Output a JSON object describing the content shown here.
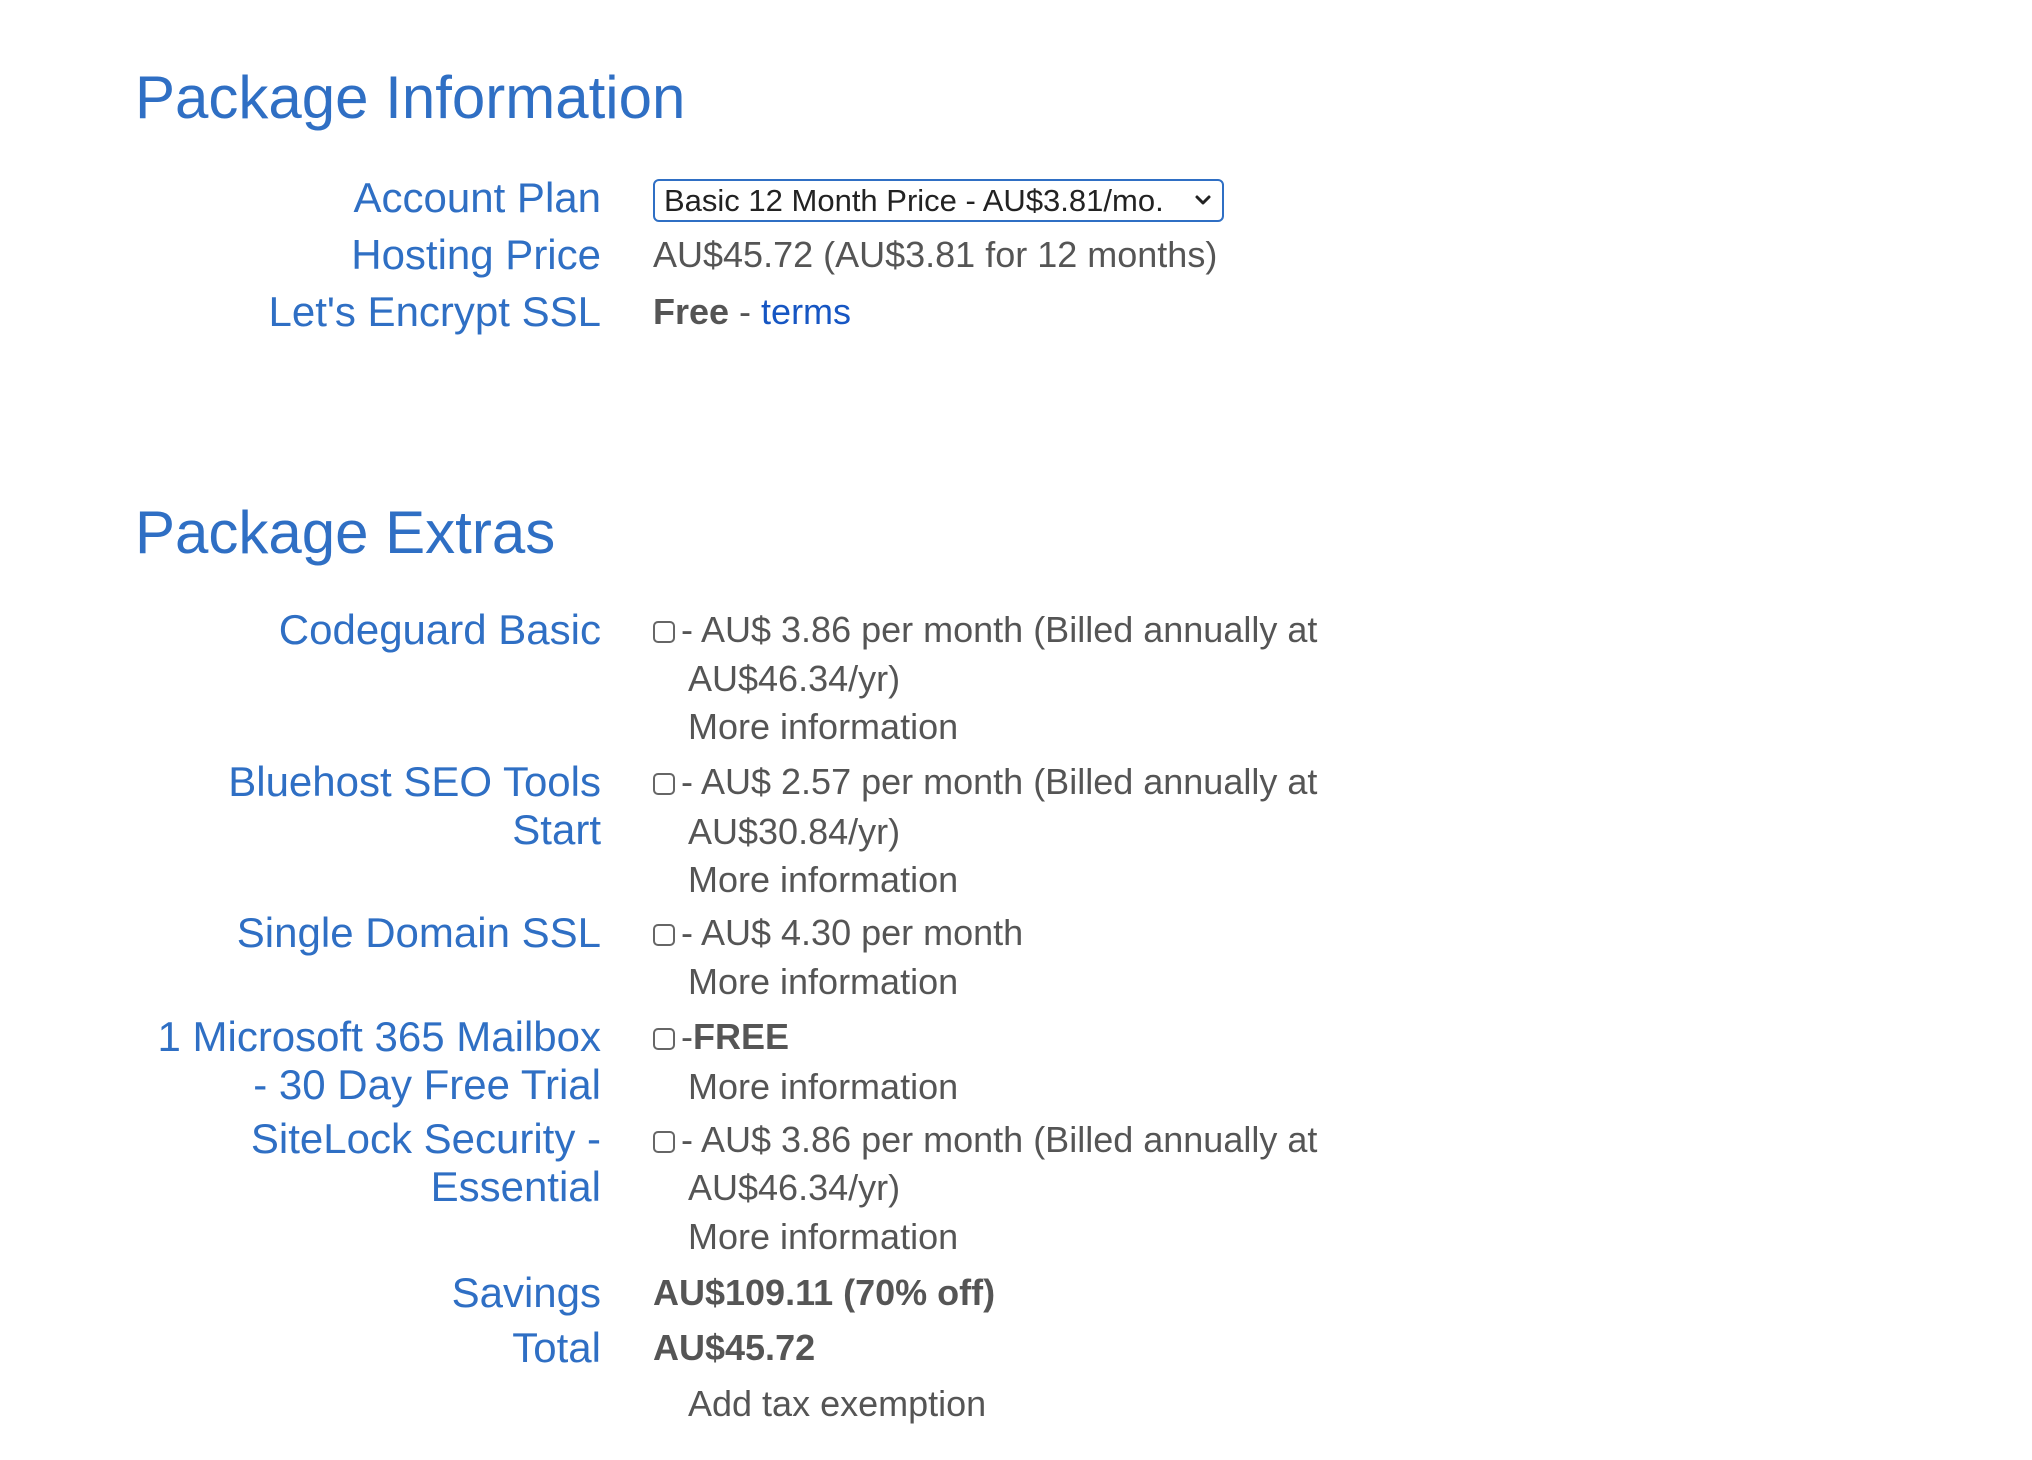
{
  "package_information": {
    "title": "Package Information",
    "account_plan": {
      "label": "Account Plan",
      "selected": "Basic 12 Month Price - AU$3.81/mo."
    },
    "hosting_price": {
      "label": "Hosting Price",
      "value": "AU$45.72  (AU$3.81 for 12 months)"
    },
    "ssl": {
      "label": "Let's Encrypt SSL",
      "value": "Free",
      "separator": " - ",
      "link": "terms"
    }
  },
  "package_extras": {
    "title": "Package Extras",
    "items": [
      {
        "label": "Codeguard Basic",
        "price_line1": "- AU$ 3.86 per month (Billed annually at",
        "price_line2": "AU$46.34/yr)",
        "link": "More information"
      },
      {
        "label_line1": "Bluehost SEO Tools",
        "label_line2": "Start",
        "price_line1": "- AU$ 2.57 per month (Billed annually at",
        "price_line2": "AU$30.84/yr)",
        "link": "More information"
      },
      {
        "label": "Single Domain SSL",
        "price_line1": "- AU$ 4.30 per month",
        "link": "More information"
      },
      {
        "label_line1": "1 Microsoft 365 Mailbox",
        "label_line2": "- 30 Day Free Trial",
        "price_prefix": "-",
        "price_bold": "FREE",
        "link": "More information"
      },
      {
        "label_line1": "SiteLock Security -",
        "label_line2": "Essential",
        "price_line1": "- AU$ 3.86 per month (Billed annually at",
        "price_line2": "AU$46.34/yr)",
        "link": "More information"
      }
    ],
    "savings": {
      "label": "Savings",
      "value": "AU$109.11 (70% off)"
    },
    "total": {
      "label": "Total",
      "value": "AU$45.72"
    },
    "tax_link": "Add tax exemption"
  },
  "colors": {
    "accent": "#2f6fc4",
    "link": "#1656c3",
    "text": "#555555"
  }
}
